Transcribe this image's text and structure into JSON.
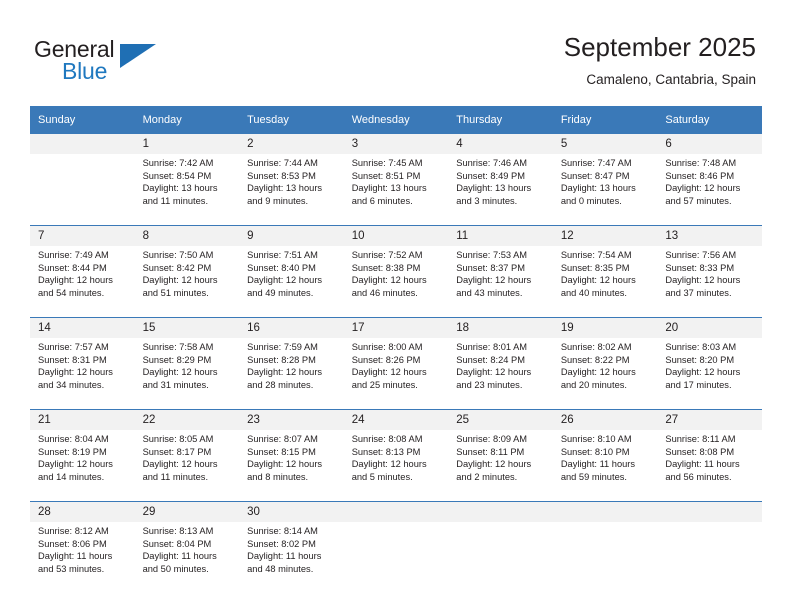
{
  "brand": {
    "name_part1": "General",
    "name_part2": "Blue",
    "flag_icon": "triangle-flag-icon"
  },
  "header": {
    "title": "September 2025",
    "location": "Camaleno, Cantabria, Spain"
  },
  "theme": {
    "header_blue": "#3a79b8",
    "daynum_gray": "#f2f2f2",
    "brand_blue": "#1f78bf",
    "text_black": "#231f20"
  },
  "weekday_headers": [
    "Sunday",
    "Monday",
    "Tuesday",
    "Wednesday",
    "Thursday",
    "Friday",
    "Saturday"
  ],
  "weeks": [
    [
      {
        "day": "",
        "sunrise": "",
        "sunset": "",
        "daylight1": "",
        "daylight2": ""
      },
      {
        "day": "1",
        "sunrise": "Sunrise: 7:42 AM",
        "sunset": "Sunset: 8:54 PM",
        "daylight1": "Daylight: 13 hours",
        "daylight2": "and 11 minutes."
      },
      {
        "day": "2",
        "sunrise": "Sunrise: 7:44 AM",
        "sunset": "Sunset: 8:53 PM",
        "daylight1": "Daylight: 13 hours",
        "daylight2": "and 9 minutes."
      },
      {
        "day": "3",
        "sunrise": "Sunrise: 7:45 AM",
        "sunset": "Sunset: 8:51 PM",
        "daylight1": "Daylight: 13 hours",
        "daylight2": "and 6 minutes."
      },
      {
        "day": "4",
        "sunrise": "Sunrise: 7:46 AM",
        "sunset": "Sunset: 8:49 PM",
        "daylight1": "Daylight: 13 hours",
        "daylight2": "and 3 minutes."
      },
      {
        "day": "5",
        "sunrise": "Sunrise: 7:47 AM",
        "sunset": "Sunset: 8:47 PM",
        "daylight1": "Daylight: 13 hours",
        "daylight2": "and 0 minutes."
      },
      {
        "day": "6",
        "sunrise": "Sunrise: 7:48 AM",
        "sunset": "Sunset: 8:46 PM",
        "daylight1": "Daylight: 12 hours",
        "daylight2": "and 57 minutes."
      }
    ],
    [
      {
        "day": "7",
        "sunrise": "Sunrise: 7:49 AM",
        "sunset": "Sunset: 8:44 PM",
        "daylight1": "Daylight: 12 hours",
        "daylight2": "and 54 minutes."
      },
      {
        "day": "8",
        "sunrise": "Sunrise: 7:50 AM",
        "sunset": "Sunset: 8:42 PM",
        "daylight1": "Daylight: 12 hours",
        "daylight2": "and 51 minutes."
      },
      {
        "day": "9",
        "sunrise": "Sunrise: 7:51 AM",
        "sunset": "Sunset: 8:40 PM",
        "daylight1": "Daylight: 12 hours",
        "daylight2": "and 49 minutes."
      },
      {
        "day": "10",
        "sunrise": "Sunrise: 7:52 AM",
        "sunset": "Sunset: 8:38 PM",
        "daylight1": "Daylight: 12 hours",
        "daylight2": "and 46 minutes."
      },
      {
        "day": "11",
        "sunrise": "Sunrise: 7:53 AM",
        "sunset": "Sunset: 8:37 PM",
        "daylight1": "Daylight: 12 hours",
        "daylight2": "and 43 minutes."
      },
      {
        "day": "12",
        "sunrise": "Sunrise: 7:54 AM",
        "sunset": "Sunset: 8:35 PM",
        "daylight1": "Daylight: 12 hours",
        "daylight2": "and 40 minutes."
      },
      {
        "day": "13",
        "sunrise": "Sunrise: 7:56 AM",
        "sunset": "Sunset: 8:33 PM",
        "daylight1": "Daylight: 12 hours",
        "daylight2": "and 37 minutes."
      }
    ],
    [
      {
        "day": "14",
        "sunrise": "Sunrise: 7:57 AM",
        "sunset": "Sunset: 8:31 PM",
        "daylight1": "Daylight: 12 hours",
        "daylight2": "and 34 minutes."
      },
      {
        "day": "15",
        "sunrise": "Sunrise: 7:58 AM",
        "sunset": "Sunset: 8:29 PM",
        "daylight1": "Daylight: 12 hours",
        "daylight2": "and 31 minutes."
      },
      {
        "day": "16",
        "sunrise": "Sunrise: 7:59 AM",
        "sunset": "Sunset: 8:28 PM",
        "daylight1": "Daylight: 12 hours",
        "daylight2": "and 28 minutes."
      },
      {
        "day": "17",
        "sunrise": "Sunrise: 8:00 AM",
        "sunset": "Sunset: 8:26 PM",
        "daylight1": "Daylight: 12 hours",
        "daylight2": "and 25 minutes."
      },
      {
        "day": "18",
        "sunrise": "Sunrise: 8:01 AM",
        "sunset": "Sunset: 8:24 PM",
        "daylight1": "Daylight: 12 hours",
        "daylight2": "and 23 minutes."
      },
      {
        "day": "19",
        "sunrise": "Sunrise: 8:02 AM",
        "sunset": "Sunset: 8:22 PM",
        "daylight1": "Daylight: 12 hours",
        "daylight2": "and 20 minutes."
      },
      {
        "day": "20",
        "sunrise": "Sunrise: 8:03 AM",
        "sunset": "Sunset: 8:20 PM",
        "daylight1": "Daylight: 12 hours",
        "daylight2": "and 17 minutes."
      }
    ],
    [
      {
        "day": "21",
        "sunrise": "Sunrise: 8:04 AM",
        "sunset": "Sunset: 8:19 PM",
        "daylight1": "Daylight: 12 hours",
        "daylight2": "and 14 minutes."
      },
      {
        "day": "22",
        "sunrise": "Sunrise: 8:05 AM",
        "sunset": "Sunset: 8:17 PM",
        "daylight1": "Daylight: 12 hours",
        "daylight2": "and 11 minutes."
      },
      {
        "day": "23",
        "sunrise": "Sunrise: 8:07 AM",
        "sunset": "Sunset: 8:15 PM",
        "daylight1": "Daylight: 12 hours",
        "daylight2": "and 8 minutes."
      },
      {
        "day": "24",
        "sunrise": "Sunrise: 8:08 AM",
        "sunset": "Sunset: 8:13 PM",
        "daylight1": "Daylight: 12 hours",
        "daylight2": "and 5 minutes."
      },
      {
        "day": "25",
        "sunrise": "Sunrise: 8:09 AM",
        "sunset": "Sunset: 8:11 PM",
        "daylight1": "Daylight: 12 hours",
        "daylight2": "and 2 minutes."
      },
      {
        "day": "26",
        "sunrise": "Sunrise: 8:10 AM",
        "sunset": "Sunset: 8:10 PM",
        "daylight1": "Daylight: 11 hours",
        "daylight2": "and 59 minutes."
      },
      {
        "day": "27",
        "sunrise": "Sunrise: 8:11 AM",
        "sunset": "Sunset: 8:08 PM",
        "daylight1": "Daylight: 11 hours",
        "daylight2": "and 56 minutes."
      }
    ],
    [
      {
        "day": "28",
        "sunrise": "Sunrise: 8:12 AM",
        "sunset": "Sunset: 8:06 PM",
        "daylight1": "Daylight: 11 hours",
        "daylight2": "and 53 minutes."
      },
      {
        "day": "29",
        "sunrise": "Sunrise: 8:13 AM",
        "sunset": "Sunset: 8:04 PM",
        "daylight1": "Daylight: 11 hours",
        "daylight2": "and 50 minutes."
      },
      {
        "day": "30",
        "sunrise": "Sunrise: 8:14 AM",
        "sunset": "Sunset: 8:02 PM",
        "daylight1": "Daylight: 11 hours",
        "daylight2": "and 48 minutes."
      },
      {
        "day": "",
        "sunrise": "",
        "sunset": "",
        "daylight1": "",
        "daylight2": ""
      },
      {
        "day": "",
        "sunrise": "",
        "sunset": "",
        "daylight1": "",
        "daylight2": ""
      },
      {
        "day": "",
        "sunrise": "",
        "sunset": "",
        "daylight1": "",
        "daylight2": ""
      },
      {
        "day": "",
        "sunrise": "",
        "sunset": "",
        "daylight1": "",
        "daylight2": ""
      }
    ]
  ]
}
